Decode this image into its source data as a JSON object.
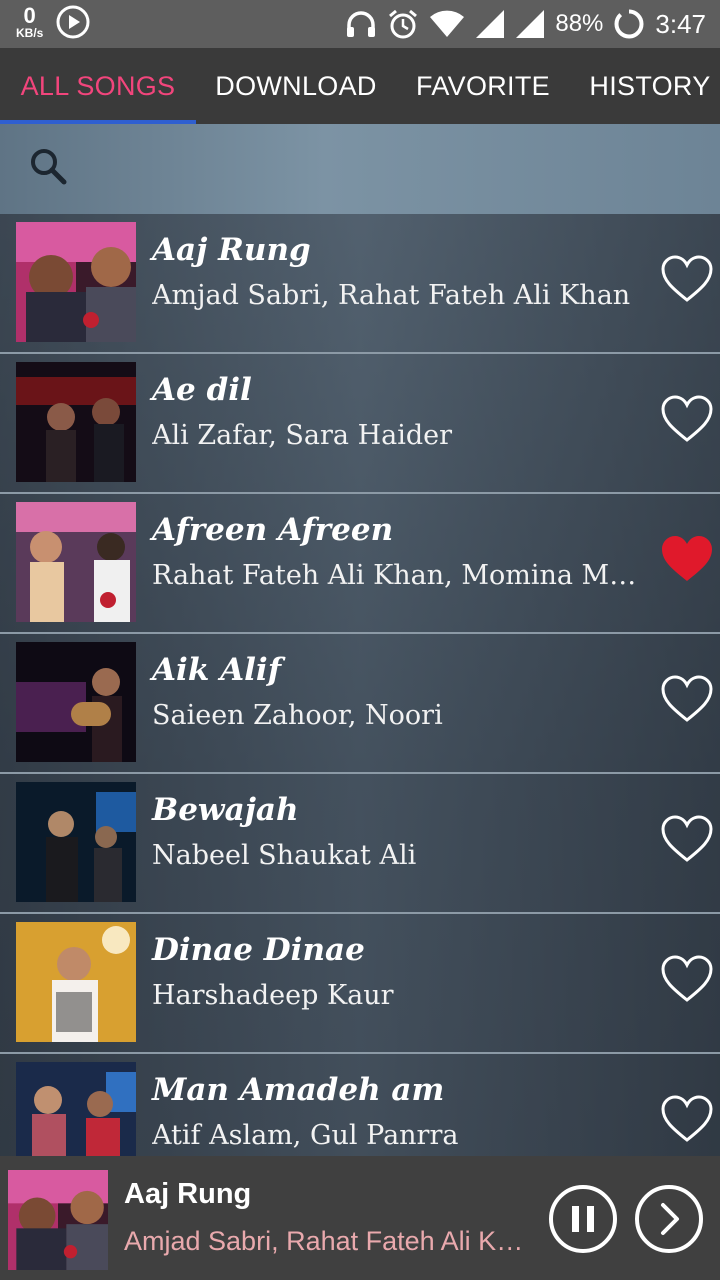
{
  "status_bar": {
    "net_speed_value": "0",
    "net_speed_unit": "KB/s",
    "battery": "88%",
    "time": "3:47",
    "icons": [
      "play-circle-icon",
      "headphones-icon",
      "alarm-icon",
      "wifi-icon",
      "signal-icon",
      "signal-icon",
      "battery-icon"
    ]
  },
  "tabs": [
    {
      "label": "ALL SONGS",
      "active": true
    },
    {
      "label": "DOWNLOAD",
      "active": false
    },
    {
      "label": "FAVORITE",
      "active": false
    },
    {
      "label": "HISTORY",
      "active": false
    }
  ],
  "search": {
    "icon": "search-icon"
  },
  "songs": [
    {
      "title": "Aaj Rung",
      "artist": "Amjad Sabri,  Rahat Fateh Ali Khan",
      "favorite": false
    },
    {
      "title": "Ae dil",
      "artist": "Ali Zafar, Sara Haider",
      "favorite": false
    },
    {
      "title": "Afreen Afreen",
      "artist": "Rahat Fateh Ali Khan, Momina Mustehsan",
      "favorite": true
    },
    {
      "title": "Aik Alif",
      "artist": "Saieen Zahoor, Noori",
      "favorite": false
    },
    {
      "title": "Bewajah",
      "artist": "Nabeel Shaukat Ali",
      "favorite": false
    },
    {
      "title": "Dinae Dinae",
      "artist": "Harshadeep Kaur",
      "favorite": false
    },
    {
      "title": "Man Amadeh am",
      "artist": "Atif Aslam, Gul Panrra",
      "favorite": false
    }
  ],
  "player": {
    "title": "Aaj Rung",
    "artist": "Amjad Sabri,  Rahat Fateh Ali Khan",
    "pause_icon": "pause-icon",
    "next_icon": "next-icon"
  },
  "colors": {
    "active_tab": "#f2457c",
    "tab_indicator": "#2f5fd0",
    "favorite_heart": "#e0192b",
    "player_artist": "#e9a9ad"
  }
}
